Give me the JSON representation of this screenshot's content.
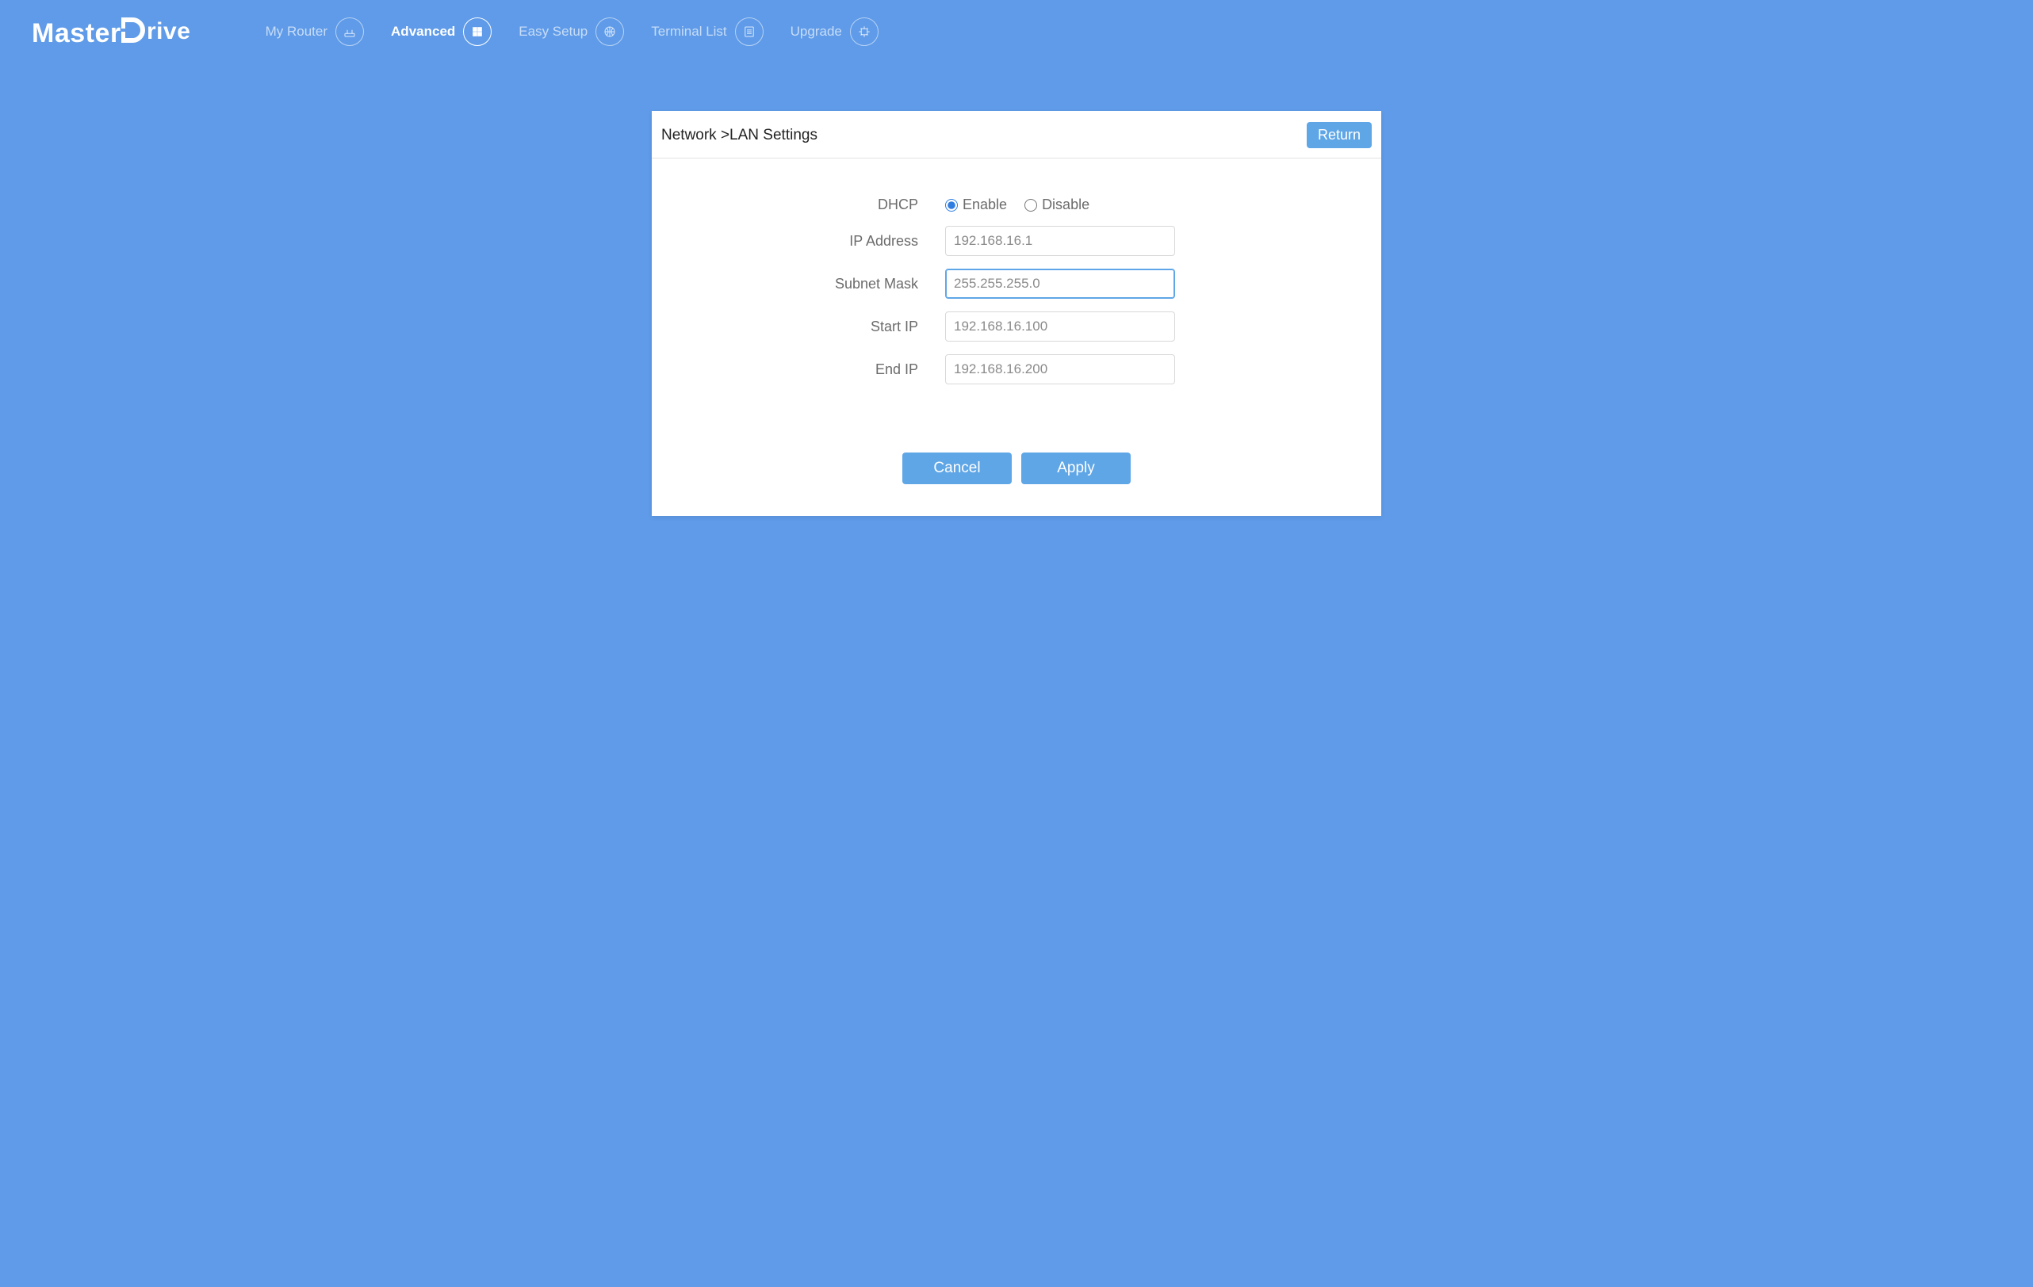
{
  "brand": {
    "name": "MasterDrive"
  },
  "nav": {
    "items": [
      {
        "label": "My Router",
        "icon": "router-icon",
        "active": false
      },
      {
        "label": "Advanced",
        "icon": "grid-icon",
        "active": true
      },
      {
        "label": "Easy Setup",
        "icon": "globe-icon",
        "active": false
      },
      {
        "label": "Terminal List",
        "icon": "list-icon",
        "active": false
      },
      {
        "label": "Upgrade",
        "icon": "chip-icon",
        "active": false
      }
    ]
  },
  "panel": {
    "breadcrumb": "Network >LAN Settings",
    "return_label": "Return"
  },
  "form": {
    "dhcp_label": "DHCP",
    "dhcp_enable_label": "Enable",
    "dhcp_disable_label": "Disable",
    "dhcp_value": "enable",
    "ip_label": "IP Address",
    "ip_value": "192.168.16.1",
    "subnet_label": "Subnet Mask",
    "subnet_value": "255.255.255.0",
    "start_label": "Start IP",
    "start_value": "192.168.16.100",
    "end_label": "End IP",
    "end_value": "192.168.16.200"
  },
  "buttons": {
    "cancel": "Cancel",
    "apply": "Apply"
  }
}
